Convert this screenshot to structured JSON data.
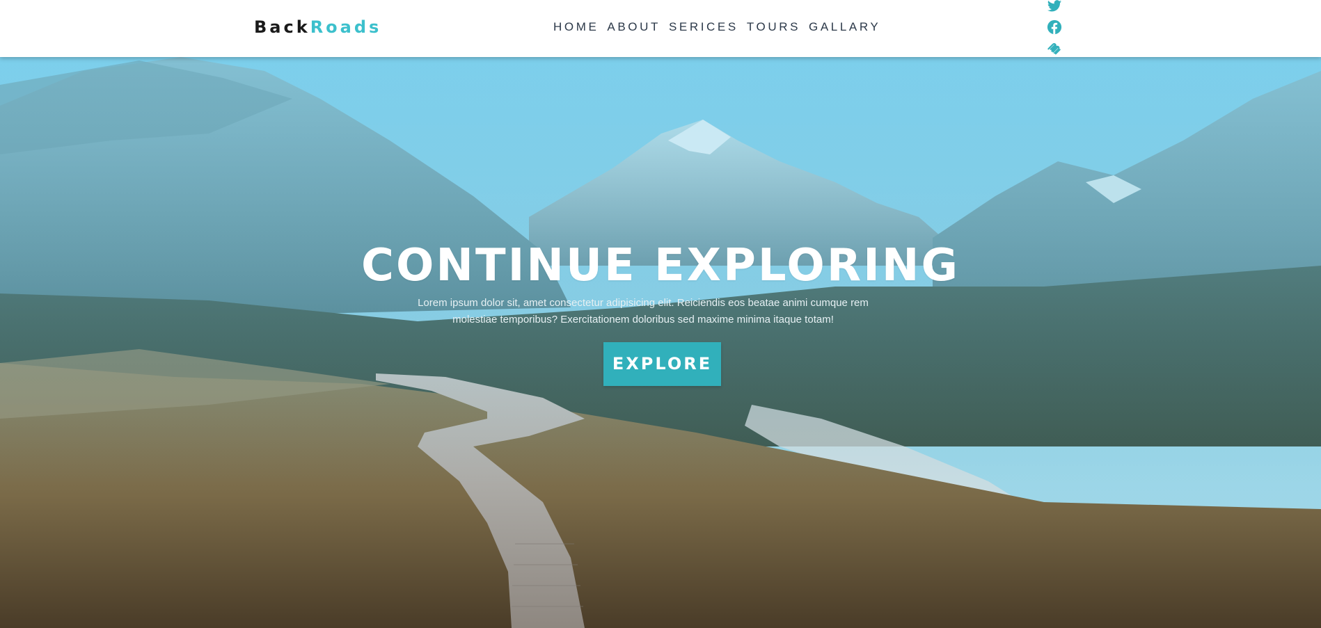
{
  "navbar": {
    "logo_part1": "Back",
    "logo_part2": "Roads",
    "links": [
      "HOME",
      "ABOUT",
      "SERICES",
      "TOURS",
      "GALLARY"
    ],
    "socials": [
      "twitter-icon",
      "facebook-icon",
      "squarespace-icon"
    ]
  },
  "hero": {
    "title": "CONTINUE EXPLORING",
    "text": "Lorem ipsum dolor sit, amet consectetur adipisicing elit. Reiciendis eos beatae animi cumque rem molestiae temporibus? Exercitationem doloribus sed maxime minima itaque totam!",
    "button_label": "EXPLORE"
  },
  "colors": {
    "accent": "#31b0bb",
    "logo_accent": "#3cc0cc",
    "nav_text": "#2b3848"
  }
}
